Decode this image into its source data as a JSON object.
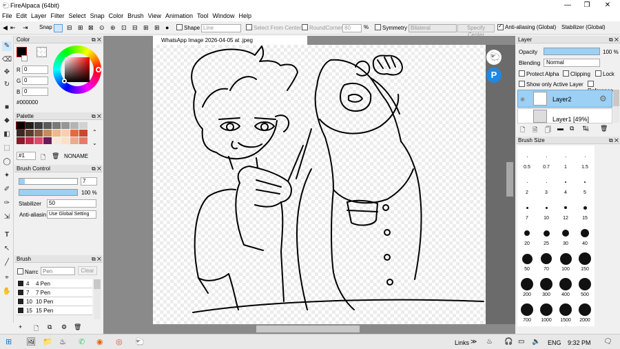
{
  "window": {
    "title": "FireAlpaca (64bit)",
    "min": "—",
    "max": "❐",
    "close": "✕"
  },
  "menu": [
    "File",
    "Edit",
    "Layer",
    "Filter",
    "Select",
    "Snap",
    "Color",
    "Brush",
    "View",
    "Animation",
    "Tool",
    "Window",
    "Help"
  ],
  "toolbar": {
    "snap": "Snap",
    "shape_label": "Shape",
    "shape_value": "Line",
    "select_from_center": "Select From Center",
    "round_corner": "RoundCorner",
    "round_value": "80",
    "percent": "%",
    "symmetry": "Symmetry",
    "symmetry_value": "Bilateral",
    "specify_center": "Specify Center",
    "antialias": "Anti-aliasing (Global)",
    "stabilizer": "Stabilizer (Global)"
  },
  "color_panel": {
    "title": "Color",
    "r_label": "R",
    "g_label": "G",
    "b_label": "B",
    "r": "0",
    "g": "0",
    "b": "0",
    "hex": "#000000"
  },
  "palette_panel": {
    "title": "Palette",
    "selected": "#1",
    "name": "NONAME"
  },
  "palette_colors": [
    "#000000",
    "#1e1e1e",
    "#3c3c3c",
    "#5a5a5a",
    "#787878",
    "#969696",
    "#b4b4b4",
    "#d2d2d2",
    "#3a2a22",
    "#5c3a2a",
    "#8a5a3e",
    "#c88a5a",
    "#f0b88a",
    "#f8d0b0",
    "#e86a3a",
    "#c84a2a",
    "#8a1a2a",
    "#c02a4a",
    "#e04a6a",
    "#6a1a5a",
    "#f8e8d8",
    "#fce0c8",
    "#f0a890",
    "#e87a6a"
  ],
  "brush_control": {
    "title": "Brush Control",
    "size": "7",
    "opacity": "100 %",
    "stabilizer_label": "Stabilizer",
    "stabilizer_value": "50",
    "antialias_label": "Anti-aliasin",
    "antialias_value": "Use Global Setting"
  },
  "brush_panel": {
    "title": "Brush",
    "search_label": "Narrc",
    "search_placeholder": "Pen",
    "clear": "Clear"
  },
  "brushes": [
    {
      "size": "4",
      "name": "4 Pen"
    },
    {
      "size": "7",
      "name": "7 Pen"
    },
    {
      "size": "10",
      "name": "10 Pen"
    },
    {
      "size": "15",
      "name": "15 Pen"
    }
  ],
  "document": {
    "tab": "WhatsApp Image 2026-04-05 at  .jpeg"
  },
  "layer_panel": {
    "title": "Layer",
    "opacity_label": "Opacity",
    "opacity": "100 %",
    "opacity_fraction": 1.0,
    "blending_label": "Blending",
    "blending_value": "Normal",
    "protect_alpha": "Protect Alpha",
    "clipping": "Clipping",
    "lock": "Lock",
    "show_only_active": "Show only Active Layer",
    "reference": "Reference"
  },
  "layers": [
    {
      "name": "Layer2"
    },
    {
      "name": "Layer1 [49%]"
    }
  ],
  "brush_size_panel": {
    "title": "Brush Size"
  },
  "brush_sizes": [
    "0.5",
    "0.7",
    "1",
    "1.5",
    "2",
    "3",
    "4",
    "5",
    "7",
    "10",
    "12",
    "15",
    "20",
    "25",
    "30",
    "40",
    "50",
    "70",
    "100",
    "150",
    "200",
    "300",
    "400",
    "500",
    "700",
    "1000",
    "1500",
    "2000"
  ],
  "taskbar": {
    "links": "Links",
    "language": "ENG",
    "time": "9:32 PM"
  }
}
